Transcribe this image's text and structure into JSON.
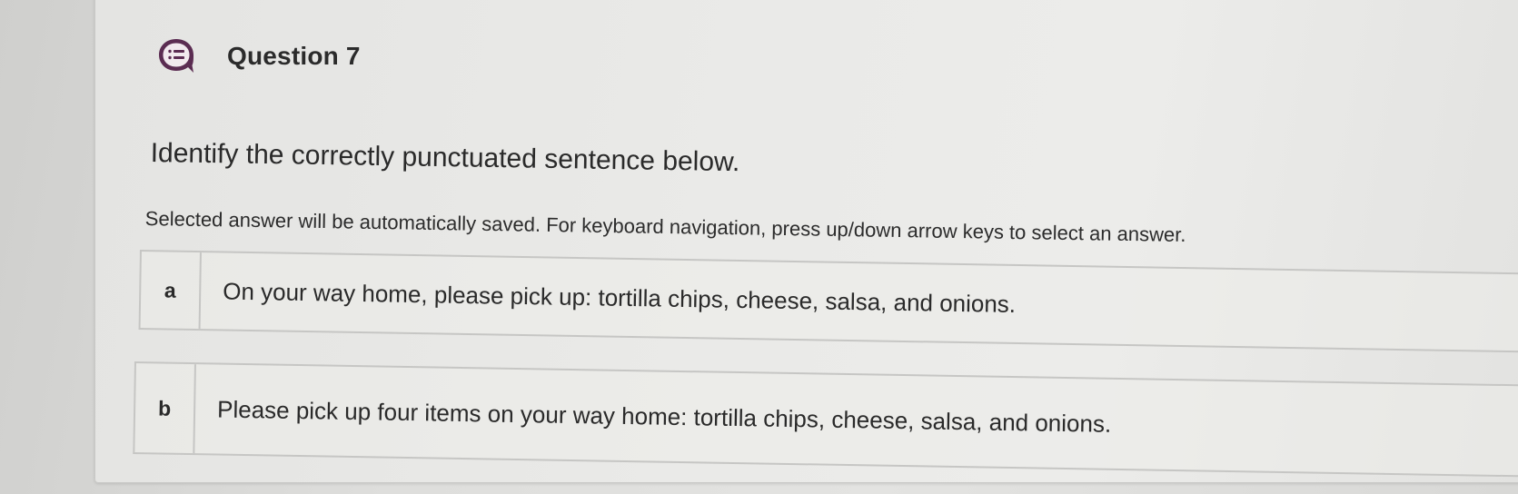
{
  "question": {
    "icon": "list-bubble-icon",
    "title": "Question 7",
    "prompt": "Identify the correctly punctuated sentence below.",
    "instructions": "Selected answer will be automatically saved. For keyboard navigation, press up/down arrow keys to select an answer."
  },
  "options": [
    {
      "letter": "a",
      "text": "On your way home, please pick up: tortilla chips, cheese, salsa, and onions."
    },
    {
      "letter": "b",
      "text": "Please pick up four items on your way home: tortilla chips, cheese, salsa, and onions."
    }
  ],
  "colors": {
    "icon_purple": "#5b2c52",
    "text": "#2a2a2a",
    "border": "#c6c6c4"
  }
}
